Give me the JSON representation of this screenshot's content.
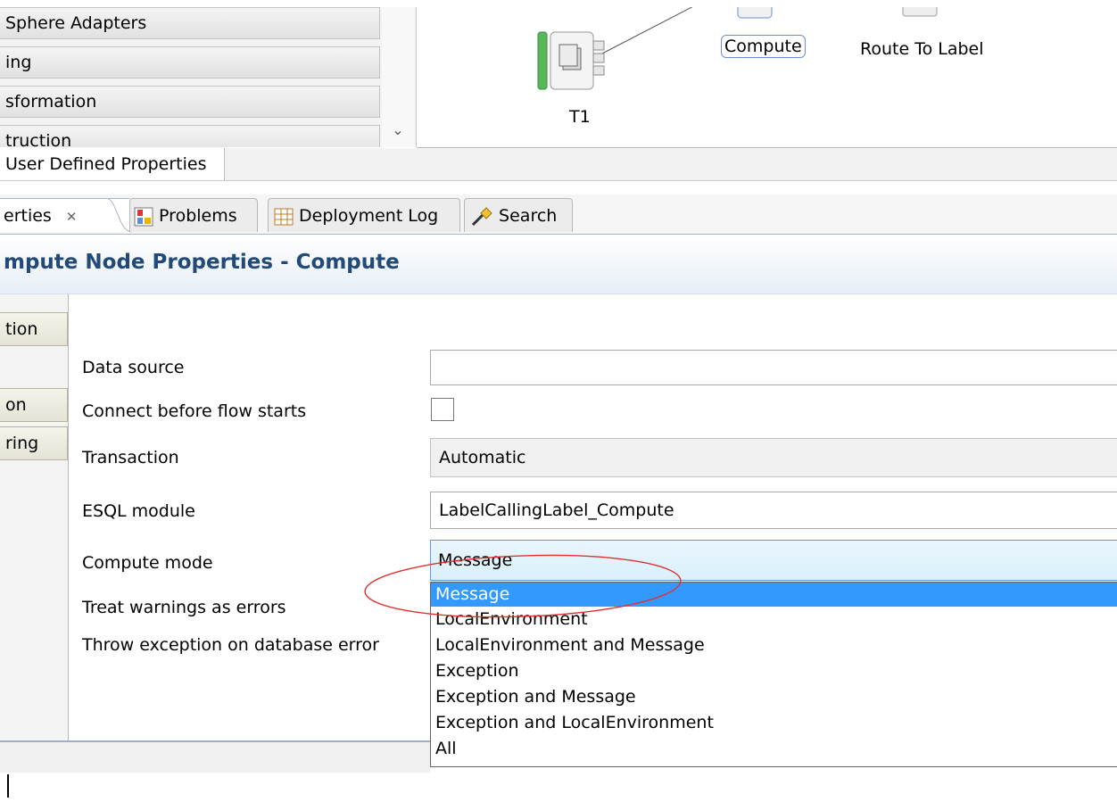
{
  "palette": {
    "drawers": [
      "Sphere Adapters",
      "ing",
      "sformation",
      "truction"
    ]
  },
  "canvas": {
    "nodes": [
      {
        "name": "compute",
        "label": "Compute"
      },
      {
        "name": "route-to-label",
        "label": "Route To Label"
      },
      {
        "name": "t1",
        "label": "T1"
      }
    ]
  },
  "udp_tab": "User Defined Properties",
  "views": {
    "tabs": [
      {
        "label": "erties",
        "close": "✕"
      },
      {
        "label": "Problems"
      },
      {
        "label": "Deployment Log"
      },
      {
        "label": "Search"
      }
    ]
  },
  "properties": {
    "title": "mpute Node Properties - Compute",
    "side_tabs": [
      "tion",
      "on",
      "ring"
    ],
    "fields": {
      "data_source": {
        "label": "Data source",
        "value": ""
      },
      "connect_before_flow": {
        "label": "Connect before flow starts",
        "checked": false
      },
      "transaction": {
        "label": "Transaction",
        "value": "Automatic"
      },
      "esql_module": {
        "label": "ESQL module",
        "value": "LabelCallingLabel_Compute"
      },
      "compute_mode": {
        "label": "Compute mode",
        "value": "Message"
      },
      "treat_warnings": {
        "label": "Treat warnings as errors"
      },
      "throw_exception": {
        "label": "Throw exception on database error"
      }
    },
    "compute_mode_options": [
      "Message",
      "LocalEnvironment",
      "LocalEnvironment and Message",
      "Exception",
      "Exception and Message",
      "Exception and LocalEnvironment",
      "All"
    ],
    "selected_option_index": 0
  },
  "colors": {
    "title": "#224a79",
    "selection": "#3399ff",
    "annotation": "#e03030",
    "combo_border": "#569de5"
  }
}
